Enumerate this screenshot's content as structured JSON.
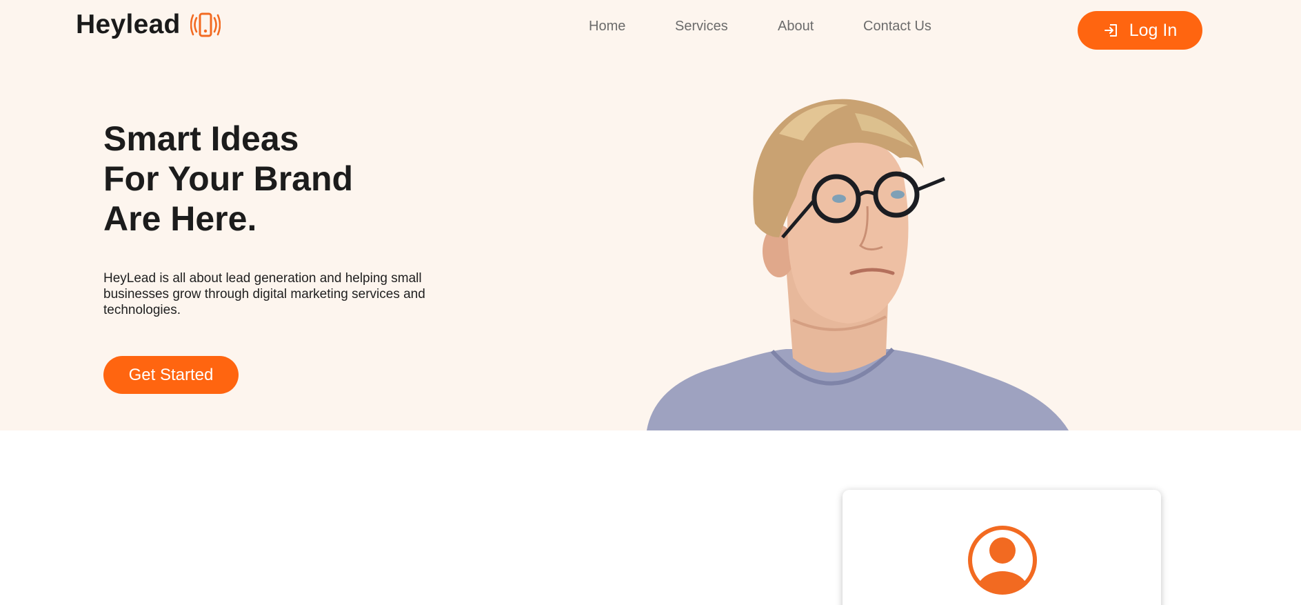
{
  "brand": {
    "name": "Heylead",
    "icon": "vibrating-phone-icon",
    "accent_color": "#ff6510"
  },
  "nav": {
    "items": [
      {
        "label": "Home"
      },
      {
        "label": "Services"
      },
      {
        "label": "About"
      },
      {
        "label": "Contact Us"
      }
    ]
  },
  "header": {
    "login_label": "Log In",
    "login_icon": "login-arrow-icon"
  },
  "hero": {
    "headline_lines": [
      "Smart Ideas",
      "For Your Brand",
      "Are Here."
    ],
    "description": "HeyLead is all about lead generation and helping small businesses grow through digital marketing services and technologies.",
    "cta_label": "Get Started",
    "background_color": "#fdf5ee"
  },
  "card": {
    "icon": "user-avatar-icon"
  }
}
